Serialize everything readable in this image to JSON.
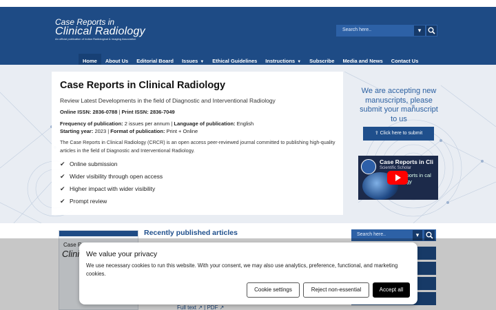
{
  "header": {
    "logo": {
      "line1": "Case Reports in",
      "line2": "Clinical Radiology",
      "tagline": "An official publication of Indian Radiological & Imaging Association"
    },
    "search": {
      "placeholder": "Search here.."
    }
  },
  "nav": {
    "items": [
      {
        "label": "Home",
        "active": true
      },
      {
        "label": "About Us"
      },
      {
        "label": "Editorial Board"
      },
      {
        "label": "Issues",
        "dropdown": true
      },
      {
        "label": "Ethical Guidelines"
      },
      {
        "label": "Instructions",
        "dropdown": true
      },
      {
        "label": "Subscribe"
      },
      {
        "label": "Media and News"
      },
      {
        "label": "Contact Us"
      }
    ]
  },
  "hero": {
    "title": "Case Reports in Clinical Radiology",
    "subtitle": "Review Latest Developments in the field of Diagnostic and Interventional Radiology",
    "issn_online_label": "Online ISSN:",
    "issn_online": "2836-0788",
    "issn_print_label": "Print ISSN:",
    "issn_print": "2836-7049",
    "frequency_label": "Frequency of publication:",
    "frequency": "2 issues per annum",
    "language_label": "Language of publication:",
    "language": "English",
    "start_label": "Starting year:",
    "start": "2023",
    "format_label": "Format of publication:",
    "format": "Print + Online",
    "description": "The Case Reports in Clinical Radiology (CRCR) is an open access peer-reviewed journal committed to publishing high-quality articles in the field of Diagnostic and Interventional Radiology.",
    "features": [
      "Online submission",
      "Wider visibility through open access",
      "Higher impact with wider visibility",
      "Prompt review"
    ]
  },
  "side": {
    "accepting": "We are accepting new manuscripts, please submit your manuscript to us",
    "submit_label": "Click here to submit",
    "video": {
      "title": "Case Reports in Cli",
      "channel": "Scientific Scholar",
      "overlay_text": "Reports in cal ology"
    }
  },
  "lower": {
    "recent_heading": "Recently published articles",
    "cover": {
      "header": "Case Reports in",
      "title": "Clinical Radiology"
    },
    "links": "Full text ↗ | PDF ↗",
    "sidebar_search_placeholder": "Search here.."
  },
  "cookie": {
    "title": "We value your privacy",
    "text": "We use necessary cookies to run this website. With your consent, we may also use analytics, preference, functional, and marketing cookies.",
    "settings_label": "Cookie settings",
    "reject_label": "Reject non-essential",
    "accept_label": "Accept all"
  },
  "colors": {
    "header": "#1e4b85",
    "accent": "#2a5fa0",
    "accept_button": "#000000"
  }
}
